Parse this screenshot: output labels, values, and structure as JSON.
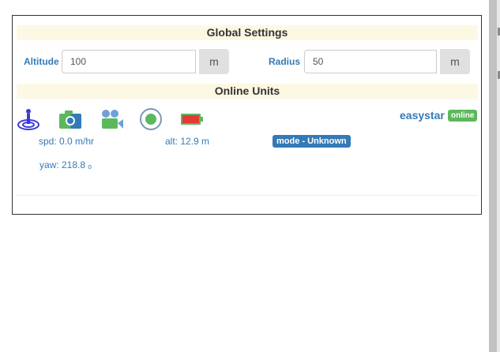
{
  "global_settings": {
    "title": "Global Settings",
    "altitude_label": "Altitude",
    "altitude_value": "100",
    "altitude_unit": "m",
    "radius_label": "Radius",
    "radius_value": "50",
    "radius_unit": "m"
  },
  "online_units": {
    "title": "Online Units",
    "unit": {
      "name": "easystar",
      "status": "online",
      "mode": "mode - Unknown",
      "speed": "spd: 0.0 m/hr",
      "altitude": "alt: 12.9 m",
      "yaw": "yaw: 218.8 ₒ"
    },
    "icons": [
      "location-pin-icon",
      "camera-icon",
      "video-camera-icon",
      "record-icon",
      "battery-icon"
    ]
  },
  "colors": {
    "header_bg": "#fcf8e3",
    "label_blue": "#337ab7",
    "online_green": "#5cb85c",
    "battery_red": "#e53935",
    "icon_green": "#5cb85c"
  }
}
